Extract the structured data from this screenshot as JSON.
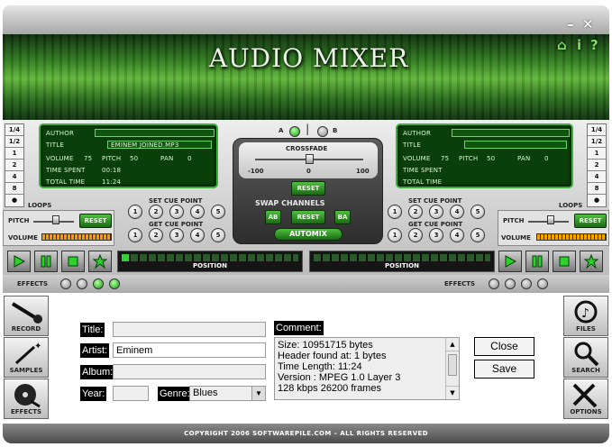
{
  "window": {
    "minimize": "–",
    "close": "✕"
  },
  "banner": {
    "title": "AUDIO MIXER",
    "icons": [
      "home-icon",
      "info-icon",
      "help-icon"
    ],
    "home": "⌂",
    "info": "i",
    "help": "?"
  },
  "loop_tabs": [
    "1/4",
    "1/2",
    "1",
    "2",
    "4",
    "8"
  ],
  "loops_label": "LOOPS",
  "deck_a": {
    "author_label": "AUTHOR",
    "author": "",
    "title_label": "TITLE",
    "title": "EMINEM JOINED.MP3",
    "volume_label": "VOLUME",
    "volume": "75",
    "pitch_label": "PITCH",
    "pitch": "50",
    "pan_label": "PAN",
    "pan": "0",
    "time_spent_label": "TIME SPENT",
    "time_spent": "00:18",
    "total_time_label": "TOTAL TIME",
    "total_time": "11:24",
    "pitch_ctrl": "PITCH",
    "reset": "RESET",
    "volume_ctrl": "VOLUME",
    "volume_level": 0.9,
    "position_label": "POSITION",
    "position": 0.03
  },
  "deck_b": {
    "author_label": "AUTHOR",
    "author": "",
    "title_label": "TITLE",
    "title": "",
    "volume_label": "VOLUME",
    "volume": "75",
    "pitch_label": "PITCH",
    "pitch": "50",
    "pan_label": "PAN",
    "pan": "0",
    "time_spent_label": "TIME SPENT",
    "time_spent": "",
    "total_time_label": "TOTAL TIME",
    "total_time": "",
    "pitch_ctrl": "PITCH",
    "reset": "RESET",
    "volume_ctrl": "VOLUME",
    "volume_level": 0.9,
    "position_label": "POSITION",
    "position": 0
  },
  "cue": {
    "set_label": "SET CUE POINT",
    "get_label": "GET CUE POINT",
    "points": [
      "1",
      "2",
      "3",
      "4",
      "5"
    ]
  },
  "center": {
    "a": "A",
    "b": "B",
    "crossfade": "CROSSFADE",
    "min": "-100",
    "mid": "0",
    "max": "100",
    "crossfade_value": 0,
    "reset": "RESET",
    "swap": "SWAP CHANNELS",
    "ab": "AB",
    "swap_reset": "RESET",
    "ba": "BA",
    "automix": "AUTOMIX"
  },
  "effects_label": "EFFECTS",
  "sidebar_left": [
    {
      "label": "RECORD"
    },
    {
      "label": "SAMPLES"
    },
    {
      "label": "EFFECTS"
    }
  ],
  "sidebar_right": [
    {
      "label": "FILES"
    },
    {
      "label": "SEARCH"
    },
    {
      "label": "OPTIONS"
    }
  ],
  "tags": {
    "title_label": "Title:",
    "title": "",
    "artist_label": "Artist:",
    "artist": "Eminem",
    "album_label": "Album:",
    "album": "",
    "year_label": "Year:",
    "year": "",
    "genre_label": "Genre:",
    "genre": "Blues",
    "comment_label": "Comment:",
    "comment_lines": [
      "Size: 10951715 bytes",
      "Header found at: 1 bytes",
      "Time Length: 11:24",
      "Version : MPEG 1.0 Layer 3",
      "128 kbps 26200 frames"
    ],
    "close": "Close",
    "save": "Save"
  },
  "footer": "COPYRIGHT 2006 SOFTWAREPILE.COM – ALL RIGHTS RESERVED"
}
